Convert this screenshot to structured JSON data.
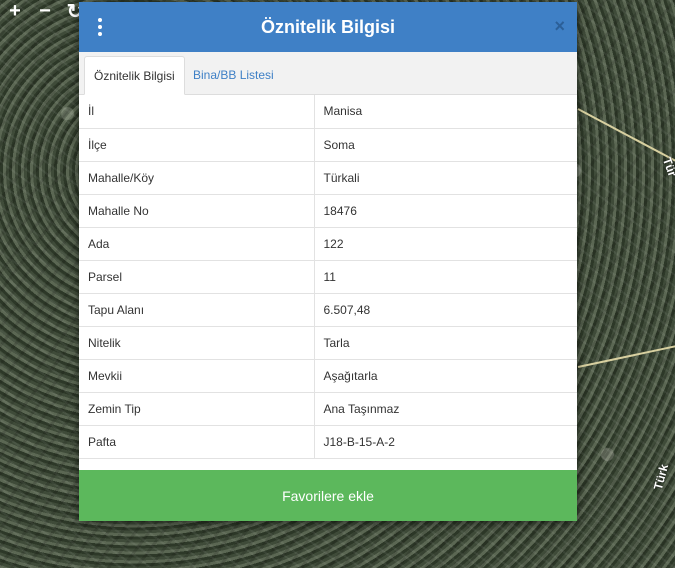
{
  "map": {
    "controls": [
      {
        "name": "zoom-in-icon",
        "symbol": "+"
      },
      {
        "name": "zoom-out-icon",
        "symbol": "−"
      },
      {
        "name": "refresh-icon",
        "symbol": "↻"
      }
    ],
    "road_labels": [
      "Tür",
      "Türk"
    ]
  },
  "dialog": {
    "title": "Öznitelik Bilgisi",
    "close_symbol": "×",
    "tabs": [
      {
        "label": "Öznitelik Bilgisi",
        "active": true
      },
      {
        "label": "Bina/BB Listesi",
        "active": false
      }
    ],
    "rows": [
      {
        "key": "İl",
        "value": "Manisa"
      },
      {
        "key": "İlçe",
        "value": "Soma"
      },
      {
        "key": "Mahalle/Köy",
        "value": "Türkali"
      },
      {
        "key": "Mahalle No",
        "value": "18476"
      },
      {
        "key": "Ada",
        "value": "122"
      },
      {
        "key": "Parsel",
        "value": "11"
      },
      {
        "key": "Tapu Alanı",
        "value": "6.507,48"
      },
      {
        "key": "Nitelik",
        "value": "Tarla"
      },
      {
        "key": "Mevkii",
        "value": "Aşağıtarla"
      },
      {
        "key": "Zemin Tip",
        "value": "Ana Taşınmaz"
      },
      {
        "key": "Pafta",
        "value": "J18-B-15-A-2"
      }
    ],
    "favorite_button": "Favorilere ekle"
  },
  "colors": {
    "header": "#3f80c6",
    "button": "#5cb85c",
    "tab_link": "#3f80c6"
  }
}
